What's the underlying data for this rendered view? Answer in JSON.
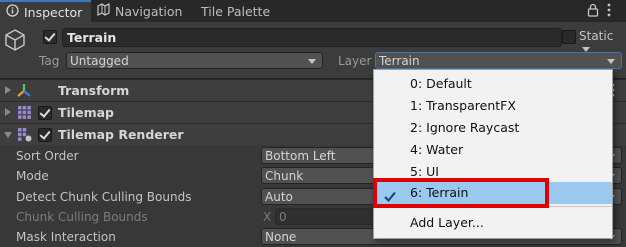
{
  "tabs": [
    {
      "label": "Inspector",
      "icon": "info-icon",
      "active": true
    },
    {
      "label": "Navigation",
      "icon": "navigation-icon",
      "active": false
    },
    {
      "label": "Tile Palette",
      "icon": "",
      "active": false
    }
  ],
  "header": {
    "object_name": "Terrain",
    "active": true,
    "static_label": "Static",
    "tag_label": "Tag",
    "tag_value": "Untagged",
    "layer_label": "Layer",
    "layer_value": "Terrain"
  },
  "components": [
    {
      "title": "Transform",
      "icon": "transform-icon",
      "expanded": false
    },
    {
      "title": "Tilemap",
      "icon": "tilemap-icon",
      "expanded": false,
      "enabled": true
    },
    {
      "title": "Tilemap Renderer",
      "icon": "tilemap-renderer-icon",
      "expanded": true,
      "enabled": true
    }
  ],
  "properties": [
    {
      "label": "Sort Order",
      "value": "Bottom Left"
    },
    {
      "label": "Mode",
      "value": "Chunk"
    },
    {
      "label": "Detect Chunk Culling Bounds",
      "value": "Auto"
    },
    {
      "label": "Chunk Culling Bounds",
      "axis_label": "X",
      "axis_value": "0"
    },
    {
      "label": "Mask Interaction",
      "value": "None"
    }
  ],
  "layer_popup": {
    "options": [
      {
        "label": "0: Default"
      },
      {
        "label": "1: TransparentFX"
      },
      {
        "label": "2: Ignore Raycast"
      },
      {
        "label": "4: Water"
      },
      {
        "label": "5: UI"
      },
      {
        "label": "6: Terrain",
        "selected": true
      }
    ],
    "add_label": "Add Layer..."
  },
  "colors": {
    "accent_blue": "#3a79bb",
    "selected_option": "#99c9ef",
    "highlight_red": "#e00000"
  }
}
